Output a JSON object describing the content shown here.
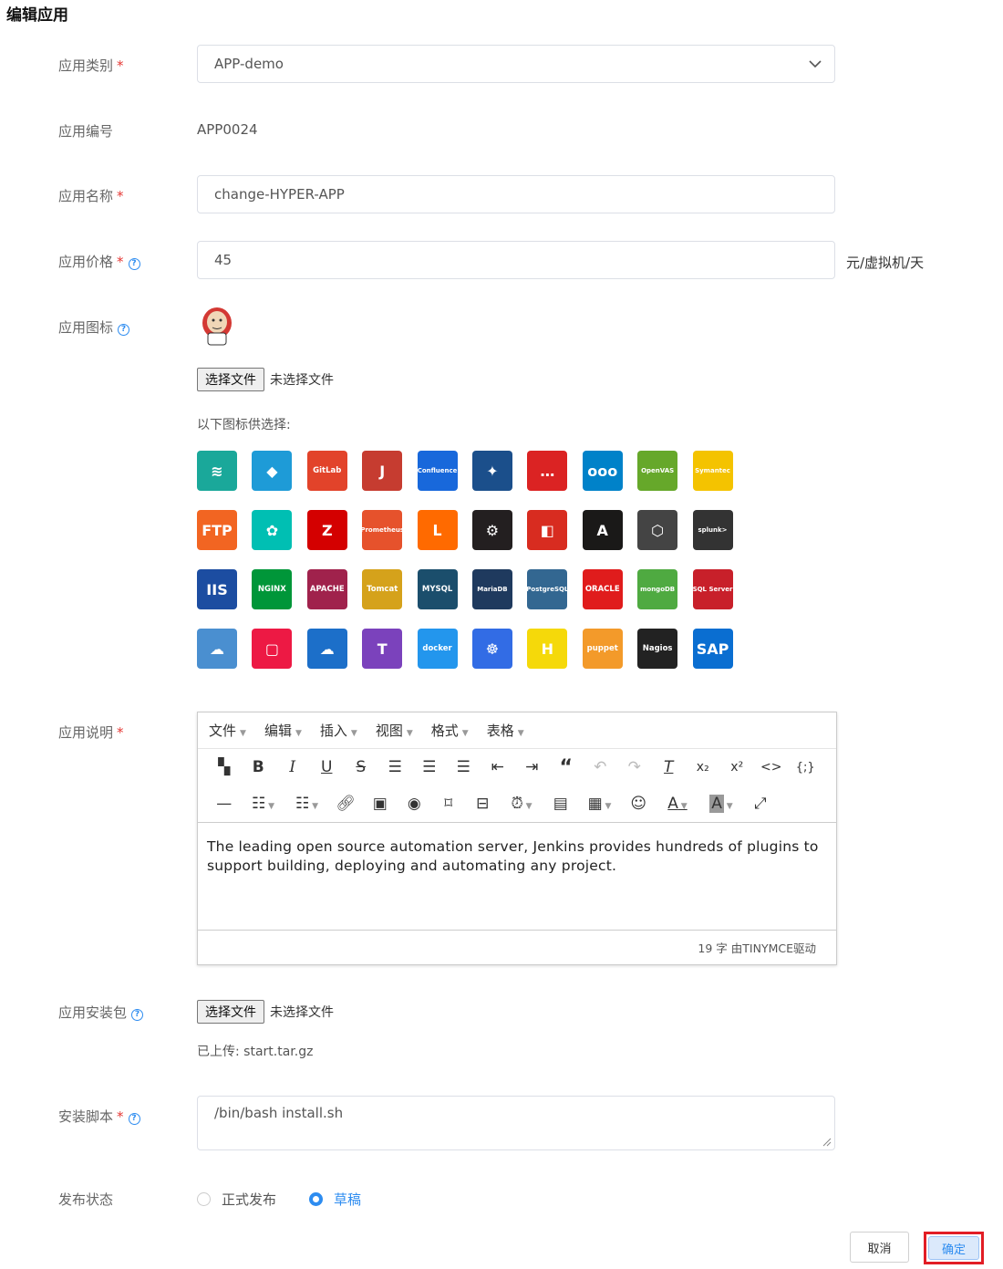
{
  "page": {
    "title": "编辑应用"
  },
  "form": {
    "category": {
      "label": "应用类别",
      "value": "APP-demo"
    },
    "code": {
      "label": "应用编号",
      "value": "APP0024"
    },
    "name": {
      "label": "应用名称",
      "value": "change-HYPER-APP"
    },
    "price": {
      "label": "应用价格",
      "value": "45",
      "unit": "元/虚拟机/天"
    },
    "icon": {
      "label": "应用图标",
      "file_button": "选择文件",
      "file_status": "未选择文件",
      "choices_label": "以下图标供选择:",
      "options": [
        {
          "name": "stack",
          "text": "≋",
          "color": "#1aa89a"
        },
        {
          "name": "azure-ad",
          "text": "◆",
          "color": "#1e9bd7"
        },
        {
          "name": "gitlab",
          "text": "GitLab",
          "color": "#e2432a"
        },
        {
          "name": "jenkins",
          "text": "J",
          "color": "#c63c30"
        },
        {
          "name": "confluence",
          "text": "Confluence",
          "color": "#1868db"
        },
        {
          "name": "jira",
          "text": "✦",
          "color": "#1b4f8b"
        },
        {
          "name": "rocketchat",
          "text": "…",
          "color": "#db2323"
        },
        {
          "name": "nextcloud",
          "text": "ooo",
          "color": "#0082c9"
        },
        {
          "name": "openvas",
          "text": "OpenVAS",
          "color": "#66a82a"
        },
        {
          "name": "symantec",
          "text": "Symantec",
          "color": "#f4c300"
        },
        {
          "name": "ftp",
          "text": "FTP",
          "color": "#f26522"
        },
        {
          "name": "elastic",
          "text": "✿",
          "color": "#00bfb3"
        },
        {
          "name": "zabbix",
          "text": "Z",
          "color": "#d40000"
        },
        {
          "name": "prometheus",
          "text": "Prometheus",
          "color": "#e6522c"
        },
        {
          "name": "gitea",
          "text": "ᒪ",
          "color": "#ff6a00"
        },
        {
          "name": "kafka",
          "text": "⚙",
          "color": "#231f20"
        },
        {
          "name": "redis",
          "text": "◧",
          "color": "#d82c20"
        },
        {
          "name": "ansible",
          "text": "A",
          "color": "#1a1918"
        },
        {
          "name": "box",
          "text": "⬡",
          "color": "#444444"
        },
        {
          "name": "splunk",
          "text": "splunk>",
          "color": "#333333"
        },
        {
          "name": "iis",
          "text": "IIS",
          "color": "#1c4da1"
        },
        {
          "name": "nginx",
          "text": "NGINX",
          "color": "#009639"
        },
        {
          "name": "apache",
          "text": "APACHE",
          "color": "#a0224c"
        },
        {
          "name": "tomcat",
          "text": "Tomcat",
          "color": "#d5a21b"
        },
        {
          "name": "mysql",
          "text": "MYSQL",
          "color": "#1b4e6c"
        },
        {
          "name": "mariadb",
          "text": "MariaDB",
          "color": "#1f3a5e"
        },
        {
          "name": "postgresql",
          "text": "PostgreSQL",
          "color": "#336791"
        },
        {
          "name": "oracle",
          "text": "ORACLE",
          "color": "#e01c1c"
        },
        {
          "name": "mongodb",
          "text": "mongoDB",
          "color": "#4faa41"
        },
        {
          "name": "sqlserver",
          "text": "SQL Server",
          "color": "#c8202a"
        },
        {
          "name": "spring-cloud",
          "text": "☁",
          "color": "#4a8fd0"
        },
        {
          "name": "openstack",
          "text": "▢",
          "color": "#ed1944"
        },
        {
          "name": "cloud",
          "text": "☁",
          "color": "#1c6fc9"
        },
        {
          "name": "terraform",
          "text": "T",
          "color": "#7b42bc"
        },
        {
          "name": "docker",
          "text": "docker",
          "color": "#2396ed"
        },
        {
          "name": "kubernetes",
          "text": "☸",
          "color": "#326ce5"
        },
        {
          "name": "hadoop",
          "text": "H",
          "color": "#f5d90a"
        },
        {
          "name": "puppet",
          "text": "puppet",
          "color": "#f39a2a"
        },
        {
          "name": "nagios",
          "text": "Nagios",
          "color": "#222222"
        },
        {
          "name": "sap",
          "text": "SAP",
          "color": "#0a6ed1"
        }
      ]
    },
    "description": {
      "label": "应用说明",
      "menus": [
        "文件",
        "编辑",
        "插入",
        "视图",
        "格式",
        "表格"
      ],
      "text": "The leading open source automation server, Jenkins provides hundreds of plugins to support building, deploying and automating any project.",
      "status": "19 字 由TINYMCE驱动"
    },
    "package": {
      "label": "应用安装包",
      "file_button": "选择文件",
      "file_status": "未选择文件",
      "uploaded": "已上传: start.tar.gz"
    },
    "script": {
      "label": "安装脚本",
      "value": "/bin/bash install.sh"
    },
    "publish": {
      "label": "发布状态",
      "options": [
        "正式发布",
        "草稿"
      ],
      "selected": "草稿"
    }
  },
  "actions": {
    "cancel": "取消",
    "confirm": "确定"
  },
  "colors": {
    "accent": "#2d8cf0",
    "required": "#e53935",
    "highlight": "#e21d25"
  }
}
